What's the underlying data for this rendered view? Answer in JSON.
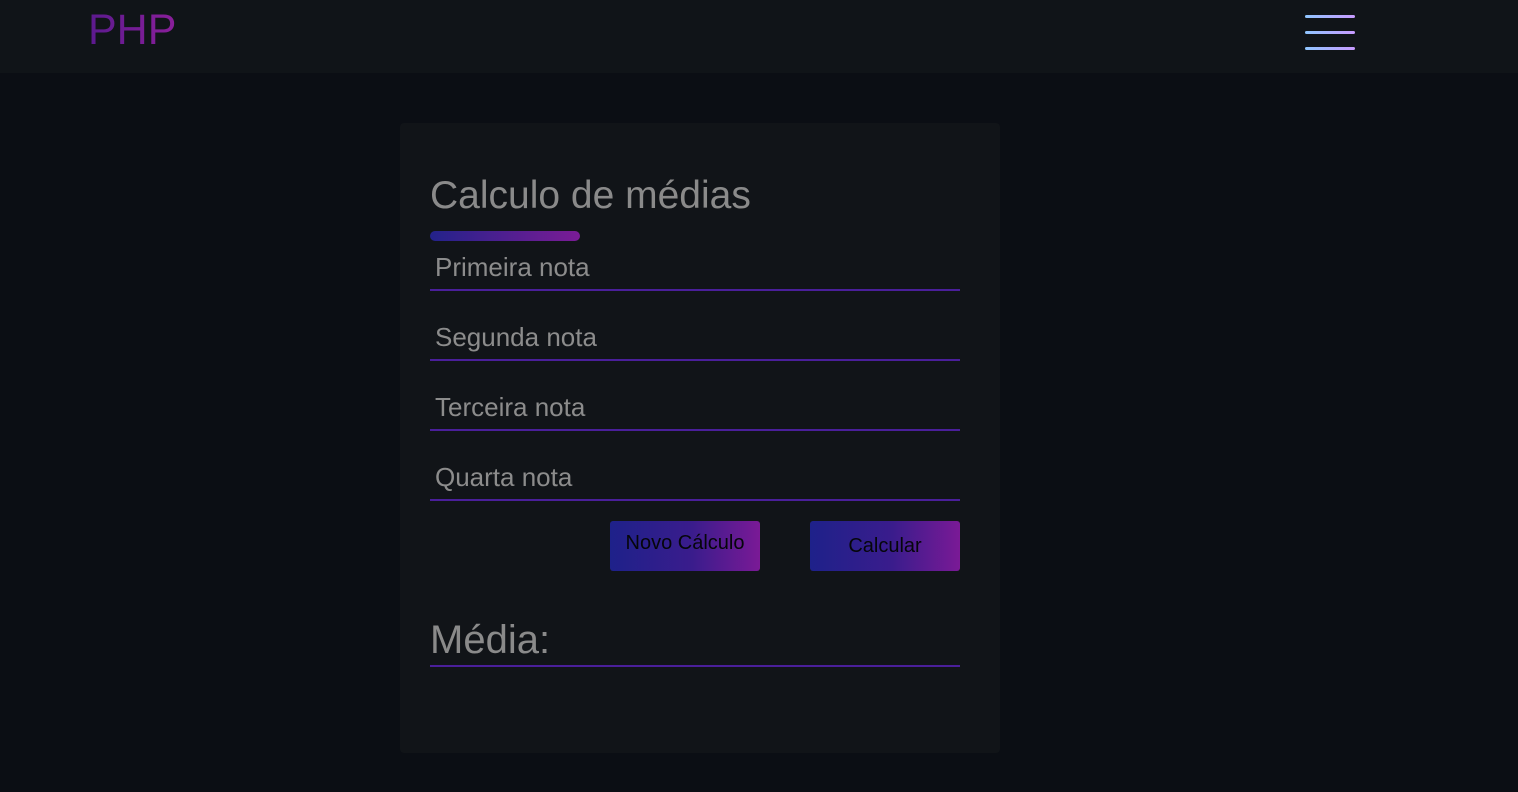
{
  "header": {
    "logo": "PHP",
    "menu_icon": "hamburger-menu-icon"
  },
  "form": {
    "title": "Calculo de médias",
    "fields": [
      {
        "placeholder": "Primeira nota",
        "value": ""
      },
      {
        "placeholder": "Segunda nota",
        "value": ""
      },
      {
        "placeholder": "Terceira nota",
        "value": ""
      },
      {
        "placeholder": "Quarta nota",
        "value": ""
      }
    ],
    "buttons": {
      "new_label": "Novo Cálculo",
      "calc_label": "Calcular"
    },
    "result_label": "Média:"
  },
  "colors": {
    "background": "#0b0e14",
    "card": "#111418",
    "accent_start": "#1e218a",
    "accent_end": "#7a1a96",
    "underline": "#4a1f9a"
  }
}
